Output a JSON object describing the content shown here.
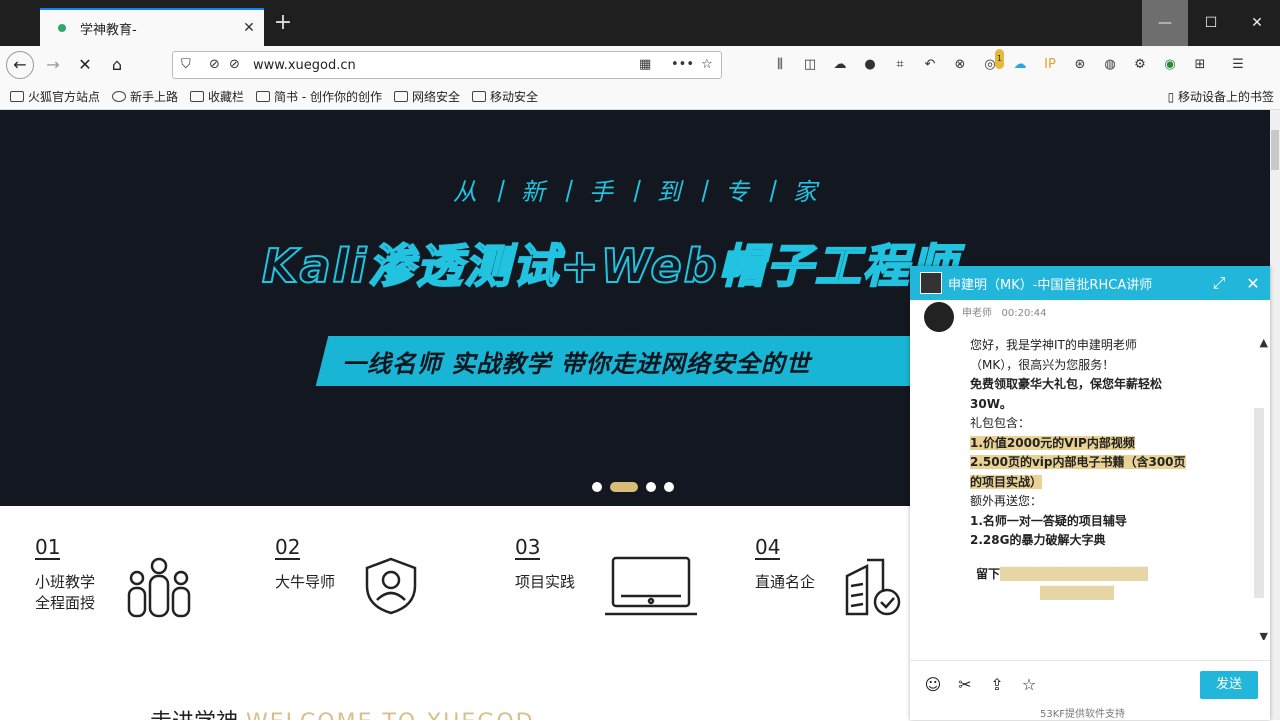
{
  "browser": {
    "tab_title": "学神教育-",
    "tab_close": "✕",
    "new_tab": "+",
    "url": "www.xuegod.cn",
    "window_controls": {
      "minimize": "—",
      "maximize": "☐",
      "close": "✕"
    },
    "toolbar_badge": "1"
  },
  "bookmarks": [
    "火狐官方站点",
    "新手上路",
    "收藏栏",
    "简书 - 创作你的创作",
    "网络安全",
    "移动安全"
  ],
  "mobile_bookmarks": "移动设备上的书签",
  "hero": {
    "subtitle": "从丨新丨手丨到丨专丨家",
    "headline": "Kali渗透测试+Web帽子工程师",
    "banner": "一线名师 实战教学 带你走进网络安全的世"
  },
  "features": [
    {
      "num": "01",
      "label1": "小班教学",
      "label2": "全程面授"
    },
    {
      "num": "02",
      "label1": "大牛导师",
      "label2": ""
    },
    {
      "num": "03",
      "label1": "项目实践",
      "label2": ""
    },
    {
      "num": "04",
      "label1": "直通名企",
      "label2": ""
    }
  ],
  "welcome": {
    "cn": "走进学神",
    "en": "WELCOME TO XUEGOD"
  },
  "chat": {
    "title": "申建明（MK）-中国首批RHCA讲师",
    "agent_name": "申老师",
    "time": "00:20:44",
    "lines": {
      "l1": "您好，我是学神IT的申建明老师",
      "l2": "（MK），很高兴为您服务！",
      "l3": "免费领取豪华大礼包，保您年薪轻松",
      "l4": "30W。",
      "l5": "礼包包含：",
      "l6": "1.价值2000元的VIP内部视频",
      "l7": "2.500页的vip内部电子书籍（含300页",
      "l8": "的项目实战）",
      "l9": "额外再送您：",
      "l10": "1.名师一对一答疑的项目辅导",
      "l11": "2.28G的暴力破解大字典",
      "l12": "留下"
    },
    "send": "发送",
    "powered": "53KF提供软件支持"
  }
}
